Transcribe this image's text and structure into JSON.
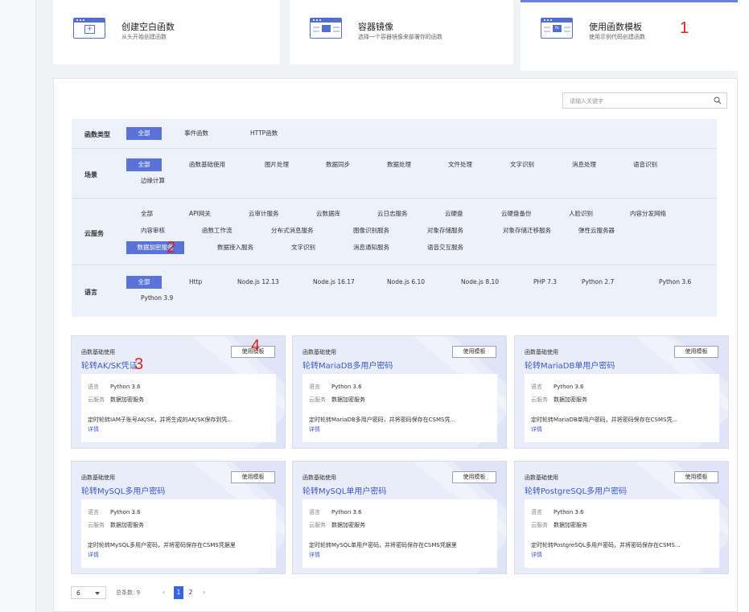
{
  "top_tabs": [
    {
      "title": "创建空白函数",
      "subtitle": "从头开始创建函数",
      "icon": "blank-function-icon"
    },
    {
      "title": "容器镜像",
      "subtitle": "选择一个容器镜像来部署你的函数",
      "icon": "container-image-icon"
    },
    {
      "title": "使用函数模板",
      "subtitle": "使用示例代码创建函数",
      "icon": "function-template-icon"
    }
  ],
  "annotations": {
    "n1": "1",
    "n2": "2",
    "n3": "3",
    "n4": "4"
  },
  "search": {
    "placeholder": "请输入关键字"
  },
  "filters": {
    "function_type": {
      "label": "函数类型",
      "options": [
        "全部",
        "事件函数",
        "HTTP函数"
      ],
      "selected": "全部"
    },
    "scene": {
      "label": "场景",
      "options": [
        "全部",
        "函数基础使用",
        "图片处理",
        "数据同步",
        "数据处理",
        "文件处理",
        "文字识别",
        "消息处理",
        "语音识别",
        "边缘计算"
      ],
      "selected": "全部"
    },
    "cloud_service": {
      "label": "云服务",
      "options": [
        "全部",
        "API网关",
        "云审计服务",
        "云数据库",
        "云日志服务",
        "云硬盘",
        "云硬盘备份",
        "人脸识别",
        "内容分发网络",
        "内容审核",
        "函数工作流",
        "分布式消息服务",
        "图像识别服务",
        "对象存储服务",
        "对象存储迁移服务",
        "弹性云服务器",
        "数据加密服务",
        "数据接入服务",
        "文字识别",
        "消息通知服务",
        "语音交互服务"
      ],
      "selected": "数据加密服务"
    },
    "language": {
      "label": "语言",
      "options": [
        "全部",
        "Http",
        "Node.js 12.13",
        "Node.js 16.17",
        "Node.js 6.10",
        "Node.js 8.10",
        "PHP 7.3",
        "Python 2.7",
        "Python 3.6",
        "Python 3.9"
      ],
      "selected": "全部"
    }
  },
  "card_labels": {
    "language_key": "语言",
    "service_key": "云服务",
    "use_button": "使用模板",
    "detail_link": "详情"
  },
  "cards": [
    {
      "category": "函数基础使用",
      "title": "轮转AK/SK凭证",
      "language": "Python 3.6",
      "service": "数据加密服务",
      "desc": "定时轮转IAM子账号AK/SK，并将生成的AK/SK保存到凭..."
    },
    {
      "category": "函数基础使用",
      "title": "轮转MariaDB多用户密码",
      "language": "Python 3.6",
      "service": "数据加密服务",
      "desc": "定时轮转MariaDB多用户密码，并将密码保存在CSMS凭..."
    },
    {
      "category": "函数基础使用",
      "title": "轮转MariaDB单用户密码",
      "language": "Python 3.6",
      "service": "数据加密服务",
      "desc": "定时轮转MariaDB单用户密码，并将密码保存在CSMS凭..."
    },
    {
      "category": "函数基础使用",
      "title": "轮转MySQL多用户密码",
      "language": "Python 3.6",
      "service": "数据加密服务",
      "desc": "定时轮转MySQL多用户密码，并将密码保存在CSMS凭据里"
    },
    {
      "category": "函数基础使用",
      "title": "轮转MySQL单用户密码",
      "language": "Python 3.6",
      "service": "数据加密服务",
      "desc": "定时轮转MySQL单用户密码，并将密码保存在CSMS凭据里"
    },
    {
      "category": "函数基础使用",
      "title": "轮转PostgreSQL多用户密码",
      "language": "Python 3.6",
      "service": "数据加密服务",
      "desc": "定时轮转PostgreSQL多用户密码，并将密码保存在CSMS..."
    }
  ],
  "pagination": {
    "page_size": "6",
    "total_label": "总条数: 9",
    "pages": [
      "1",
      "2"
    ],
    "current": "1",
    "prev": "‹",
    "next": "›"
  },
  "colors": {
    "accent": "#5b73d9",
    "title_link": "#3a5ad0",
    "annotation": "#e02020",
    "filter_bg": "#edf1fb"
  }
}
